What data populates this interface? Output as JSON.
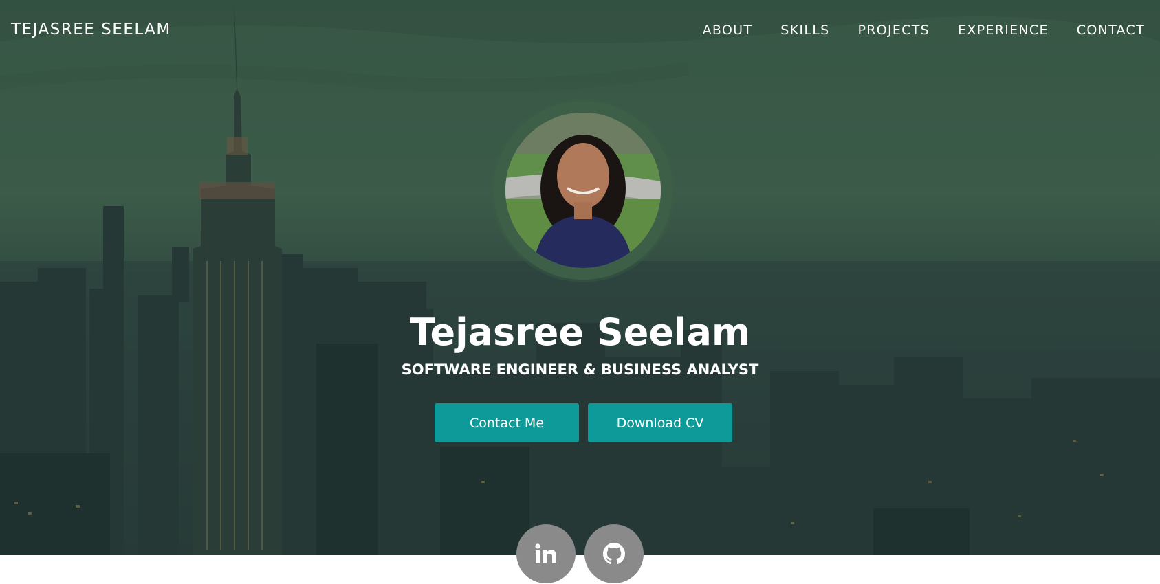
{
  "header": {
    "brand": "TEJASREE SEELAM",
    "nav": [
      {
        "label": "ABOUT"
      },
      {
        "label": "SKILLS"
      },
      {
        "label": "PROJECTS"
      },
      {
        "label": "EXPERIENCE"
      },
      {
        "label": "CONTACT"
      }
    ]
  },
  "hero": {
    "name": "Tejasree Seelam",
    "role": "SOFTWARE ENGINEER & BUSINESS ANALYST",
    "buttons": {
      "contact": "Contact Me",
      "cv": "Download CV"
    }
  },
  "social": {
    "linkedin_icon": "linkedin-icon",
    "github_icon": "github-icon"
  },
  "colors": {
    "accent": "#0e9a99",
    "social_bg": "#8a8a8a",
    "overlay_green": "#3c5a48"
  }
}
